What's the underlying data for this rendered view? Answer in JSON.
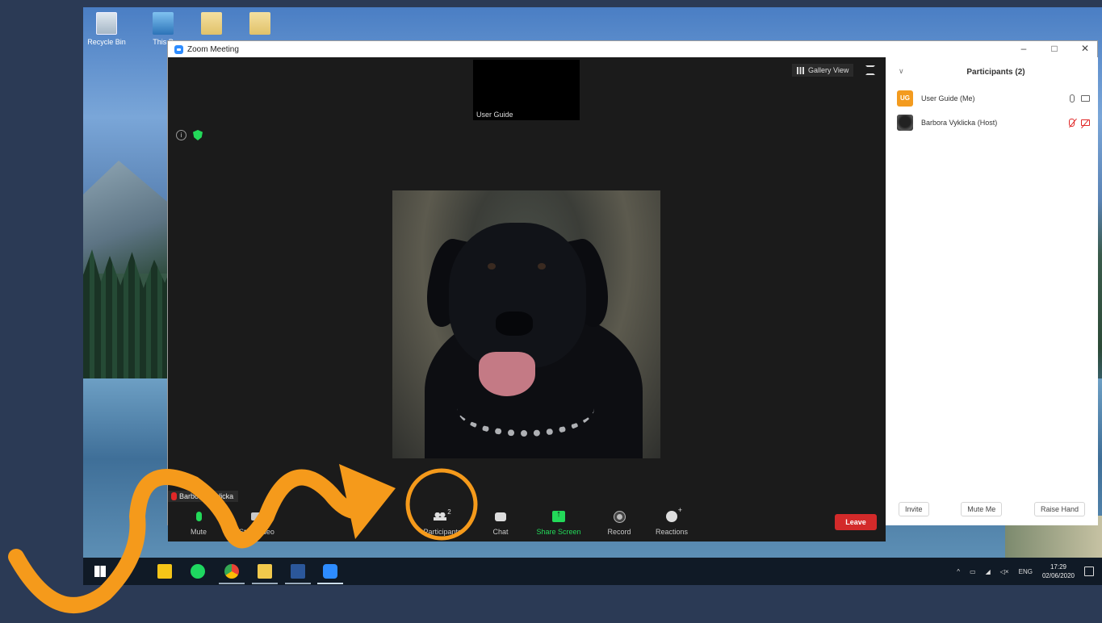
{
  "desktop": {
    "icons": [
      {
        "label": "Recycle Bin",
        "icon": "recycle-bin-icon"
      },
      {
        "label": "This P",
        "icon": "computer-icon"
      },
      {
        "label": "",
        "icon": "folder-icon"
      },
      {
        "label": "",
        "icon": "document-icon"
      }
    ]
  },
  "window": {
    "title": "Zoom Meeting",
    "controls": {
      "minimize": "–",
      "maximize": "□",
      "close": "✕"
    }
  },
  "video": {
    "thumbnail_name": "User Guide",
    "gallery_view_label": "Gallery View",
    "active_speaker_name": "Barbora Vyklicka"
  },
  "toolbar": {
    "mute_label": "Mute",
    "video_label": "Stop Video",
    "participants_label": "Participants",
    "participants_count": "2",
    "chat_label": "Chat",
    "share_label": "Share Screen",
    "record_label": "Record",
    "reactions_label": "Reactions",
    "leave_label": "Leave"
  },
  "panel": {
    "title": "Participants (2)",
    "participants": [
      {
        "initials": "UG",
        "name": "User Guide (Me)",
        "mic": "on",
        "camera": "on"
      },
      {
        "initials": "",
        "name": "Barbora Vyklicka (Host)",
        "mic": "muted",
        "camera": "off"
      }
    ],
    "invite_label": "Invite",
    "mute_me_label": "Mute Me",
    "raise_hand_label": "Raise Hand"
  },
  "taskbar": {
    "apps": [
      "windows-start",
      "sticky-notes",
      "spotify",
      "chrome",
      "file-explorer",
      "word",
      "zoom"
    ],
    "lang": "ENG",
    "time": "17:29",
    "date": "02/06/2020"
  },
  "colors": {
    "zoom_blue": "#2d8cff",
    "share_green": "#23d959",
    "leave_red": "#d32a2a",
    "annotation_orange": "#f59a1b",
    "ug_avatar": "#f39b1f"
  }
}
